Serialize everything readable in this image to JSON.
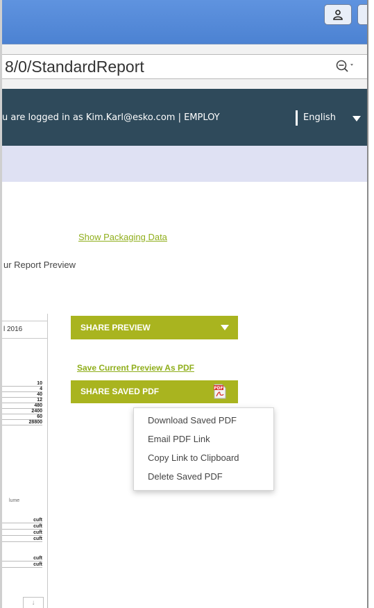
{
  "browser": {
    "url": "8/0/StandardReport",
    "icons": {
      "user": "user-icon",
      "zoom": "zoom-out-icon"
    }
  },
  "header": {
    "login_text": "u are logged in as Kim.Karl@esko.com | EMPLOY",
    "language": "English",
    "colors": {
      "background": "#2f4a5b",
      "sub_band": "#dfe1f3"
    }
  },
  "page": {
    "show_packaging_link": "Show Packaging Data",
    "report_preview_text": "ur Report Preview"
  },
  "preview_thumbnail": {
    "header": "l 2016",
    "numbers": [
      "10",
      "4",
      "40",
      "12",
      "480",
      "2400",
      "60",
      "28800"
    ],
    "unit_header": "lume",
    "units": [
      "cuft",
      "cuft",
      "cuft",
      "cuft",
      "cuft",
      "cuft"
    ]
  },
  "share": {
    "preview_button": "SHARE PREVIEW",
    "save_link": "Save Current Preview As PDF",
    "saved_pdf_button": "SHARE SAVED PDF",
    "accent_color": "#a9b41f",
    "link_color": "#8fae1b"
  },
  "menu": {
    "items": [
      "Download Saved PDF",
      "Email PDF Link",
      "Copy Link to Clipboard",
      "Delete Saved PDF"
    ]
  }
}
